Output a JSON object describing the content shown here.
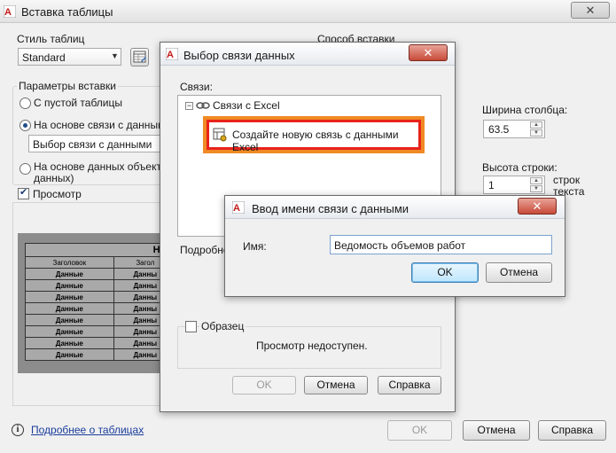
{
  "main": {
    "title": "Вставка таблицы",
    "table_style_label": "Стиль таблиц",
    "table_style_value": "Standard",
    "insert_method_label": "Способ вставки",
    "insert_params_label": "Параметры вставки",
    "option_empty": "С пустой таблицы",
    "option_datalink": "На основе связи с данными",
    "datalink_select_value": "Выбор связи с данными",
    "option_object_data": "На основе данных объекта (",
    "option_object_data_2": "данных)",
    "preview_label": "Просмотр",
    "col_width_label": "Ширина столбца:",
    "col_width_value": "63.5",
    "row_height_label": "Высота строки:",
    "row_height_value": "1",
    "row_unit_1": "строк",
    "row_unit_2": "текста",
    "help_link": "Подробнее о таблицах",
    "ok": "OK",
    "cancel": "Отмена",
    "help": "Справка",
    "preview_table": {
      "title": "Назв",
      "headers": [
        "Заголовок",
        "Загол"
      ],
      "cells": [
        "Данные",
        "Данны"
      ],
      "rows": 8
    }
  },
  "datalink_dialog": {
    "title": "Выбор связи данных",
    "links_label": "Связи:",
    "tree_root": "Связи с Excel",
    "tree_child": "Создайте новую связь с данными Excel",
    "details_label": "Подробно",
    "sample_label": "Образец",
    "no_preview": "Просмотр недоступен.",
    "ok": "OK",
    "cancel": "Отмена",
    "help": "Справка"
  },
  "name_dialog": {
    "title": "Ввод имени связи с данными",
    "name_label": "Имя:",
    "name_value": "Ведомость объемов работ",
    "ok": "OK",
    "cancel": "Отмена"
  },
  "colors": {
    "highlight_red": "#e8231b",
    "highlight_orange": "#f08a24",
    "preview_bg": "#8c8c8c",
    "link_blue": "#1a3d9c"
  }
}
